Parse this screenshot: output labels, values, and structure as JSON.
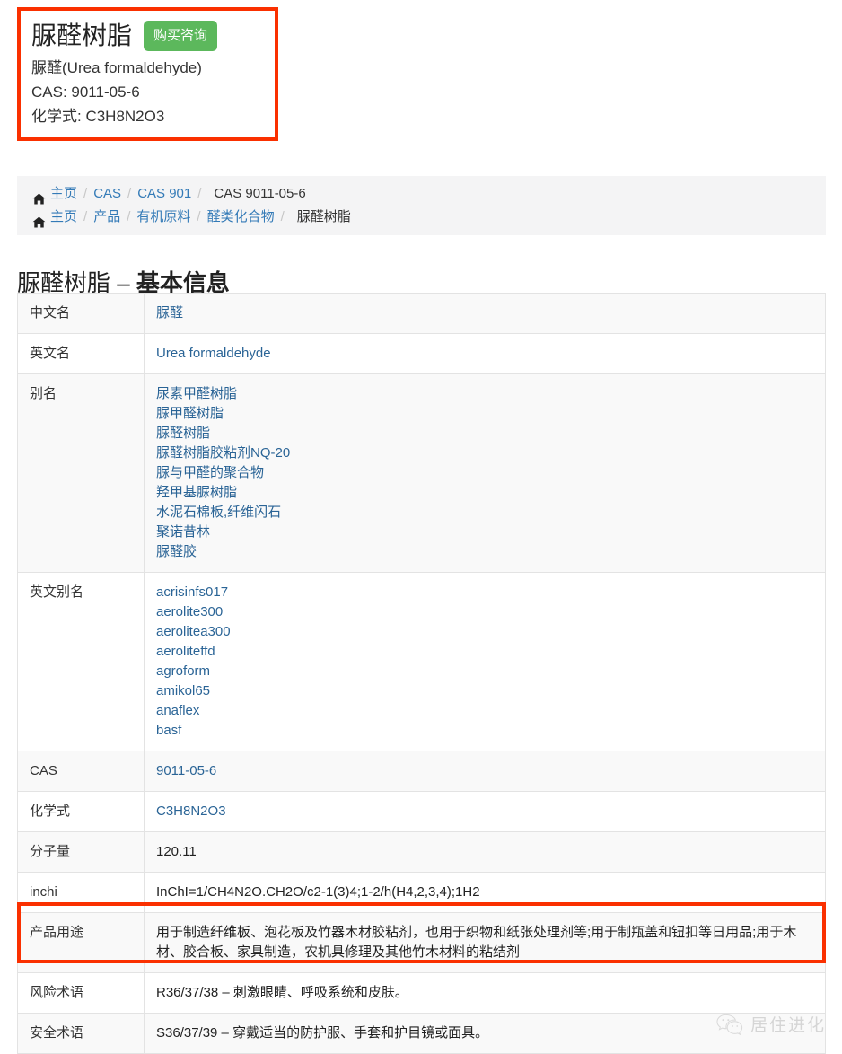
{
  "product_card": {
    "title": "脲醛树脂",
    "buy_button": "购买咨询",
    "alias_line": "脲醛(Urea formaldehyde)",
    "cas_line": "CAS: 9011-05-6",
    "formula_line": "化学式: C3H8N2O3",
    "border_color": "#fa3000",
    "button_color": "#5cb85c"
  },
  "breadcrumbs": {
    "row1": {
      "home": "主页",
      "item1": "CAS",
      "item2": "CAS 901",
      "current": "CAS 9011-05-6"
    },
    "row2": {
      "home": "主页",
      "item1": "产品",
      "item2": "有机原料",
      "item3": "醛类化合物",
      "current": "脲醛树脂"
    },
    "separator": "/"
  },
  "heading": {
    "prefix": "脲醛树脂 – ",
    "strong": "基本信息"
  },
  "table": {
    "rows": [
      {
        "label": "中文名",
        "type": "link",
        "value": "脲醛"
      },
      {
        "label": "英文名",
        "type": "link",
        "value": "Urea formaldehyde"
      },
      {
        "label": "别名",
        "type": "link-list",
        "values": [
          "尿素甲醛树脂",
          "脲甲醛树脂",
          "脲醛树脂",
          "脲醛树脂胶粘剂NQ-20",
          "脲与甲醛的聚合物",
          "羟甲基脲树脂",
          "水泥石棉板,纤维闪石",
          "聚诺昔林",
          "脲醛胶"
        ]
      },
      {
        "label": "英文别名",
        "type": "link-list",
        "values": [
          "acrisinfs017",
          "aerolite300",
          "aerolitea300",
          "aeroliteffd",
          "agroform",
          "amikol65",
          "anaflex",
          "basf"
        ]
      },
      {
        "label": "CAS",
        "type": "link",
        "value": "9011-05-6"
      },
      {
        "label": "化学式",
        "type": "link",
        "value": "C3H8N2O3"
      },
      {
        "label": "分子量",
        "type": "plain",
        "value": "120.11"
      },
      {
        "label": "inchi",
        "type": "plain",
        "value": "InChI=1/CH4N2O.CH2O/c2-1(3)4;1-2/h(H4,2,3,4);1H2"
      },
      {
        "label": "产品用途",
        "type": "plain",
        "value": "用于制造纤维板、泡花板及竹器木材胶粘剂，也用于织物和纸张处理剂等;用于制瓶盖和钮扣等日用品;用于木材、胶合板、家具制造，农机具修理及其他竹木材料的粘结剂",
        "highlighted": true
      },
      {
        "label": "风险术语",
        "type": "plain",
        "value": "R36/37/38 – 刺激眼睛、呼吸系统和皮肤。"
      },
      {
        "label": "安全术语",
        "type": "plain",
        "value": "S36/37/39 – 穿戴适当的防护服、手套和护目镜或面具。"
      }
    ]
  },
  "watermark": {
    "text": "居住进化",
    "icon": "wechat-icon"
  }
}
